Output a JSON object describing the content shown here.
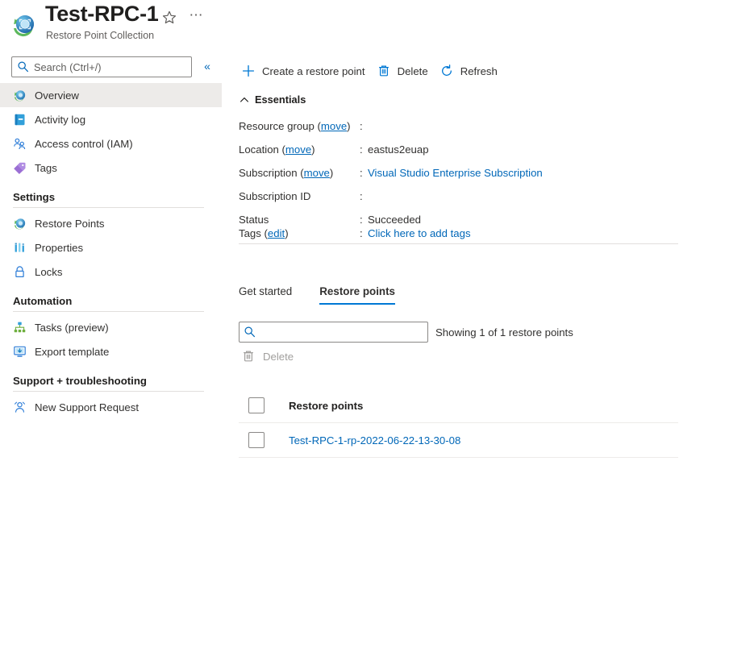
{
  "header": {
    "title": "Test-RPC-1",
    "subtitle": "Restore Point Collection",
    "favorite_icon": "star-icon",
    "more_icon": "ellipsis-icon",
    "resource_icon": "restore-point-collection-icon"
  },
  "sidebar": {
    "search": {
      "placeholder": "Search (Ctrl+/)",
      "value": ""
    },
    "collapse_label": "«",
    "items": [
      {
        "label": "Overview",
        "icon": "overview-icon",
        "selected": true
      },
      {
        "label": "Activity log",
        "icon": "activity-log-icon",
        "selected": false
      },
      {
        "label": "Access control (IAM)",
        "icon": "access-control-icon",
        "selected": false
      },
      {
        "label": "Tags",
        "icon": "tags-icon",
        "selected": false
      }
    ],
    "groups": [
      {
        "title": "Settings",
        "items": [
          {
            "label": "Restore Points",
            "icon": "restore-points-icon"
          },
          {
            "label": "Properties",
            "icon": "properties-icon"
          },
          {
            "label": "Locks",
            "icon": "lock-icon"
          }
        ]
      },
      {
        "title": "Automation",
        "items": [
          {
            "label": "Tasks (preview)",
            "icon": "tasks-icon"
          },
          {
            "label": "Export template",
            "icon": "export-template-icon"
          }
        ]
      },
      {
        "title": "Support + troubleshooting",
        "items": [
          {
            "label": "New Support Request",
            "icon": "support-request-icon"
          }
        ]
      }
    ]
  },
  "toolbar": {
    "create_label": "Create a restore point",
    "create_icon": "plus-icon",
    "delete_label": "Delete",
    "delete_icon": "trash-icon",
    "refresh_label": "Refresh",
    "refresh_icon": "refresh-icon"
  },
  "essentials": {
    "section_label": "Essentials",
    "collapse_icon": "chevron-up-icon",
    "rows": [
      {
        "key": "Resource group",
        "link": "move",
        "value": "",
        "is_link": false,
        "redacted": true
      },
      {
        "key": "Location",
        "link": "move",
        "value": "eastus2euap",
        "is_link": false,
        "redacted": false
      },
      {
        "key": "Subscription",
        "link": "move",
        "value": "Visual Studio Enterprise Subscription",
        "is_link": true,
        "redacted": false
      },
      {
        "key": "Subscription ID",
        "link": "",
        "value": "",
        "is_link": false,
        "redacted": true
      },
      {
        "key": "Status",
        "link": "",
        "value": "Succeeded",
        "is_link": false,
        "redacted": false
      }
    ],
    "tags": {
      "key": "Tags",
      "link": "edit",
      "value": "Click here to add tags"
    }
  },
  "tabs": [
    {
      "label": "Get started",
      "active": false
    },
    {
      "label": "Restore points",
      "active": true
    }
  ],
  "list": {
    "filter": {
      "placeholder": "",
      "value": "",
      "icon": "search-icon"
    },
    "showing_text": "Showing 1 of 1 restore points",
    "delete_label": "Delete",
    "delete_icon": "trash-icon",
    "column_header": "Restore points",
    "rows": [
      {
        "name": "Test-RPC-1-rp-2022-06-22-13-30-08",
        "checked": false
      }
    ]
  },
  "colors": {
    "accent": "#0078d4",
    "link": "#0067b8",
    "selected_bg": "#edebe9",
    "divider": "#e1dfdd",
    "disabled": "#a19f9d"
  }
}
